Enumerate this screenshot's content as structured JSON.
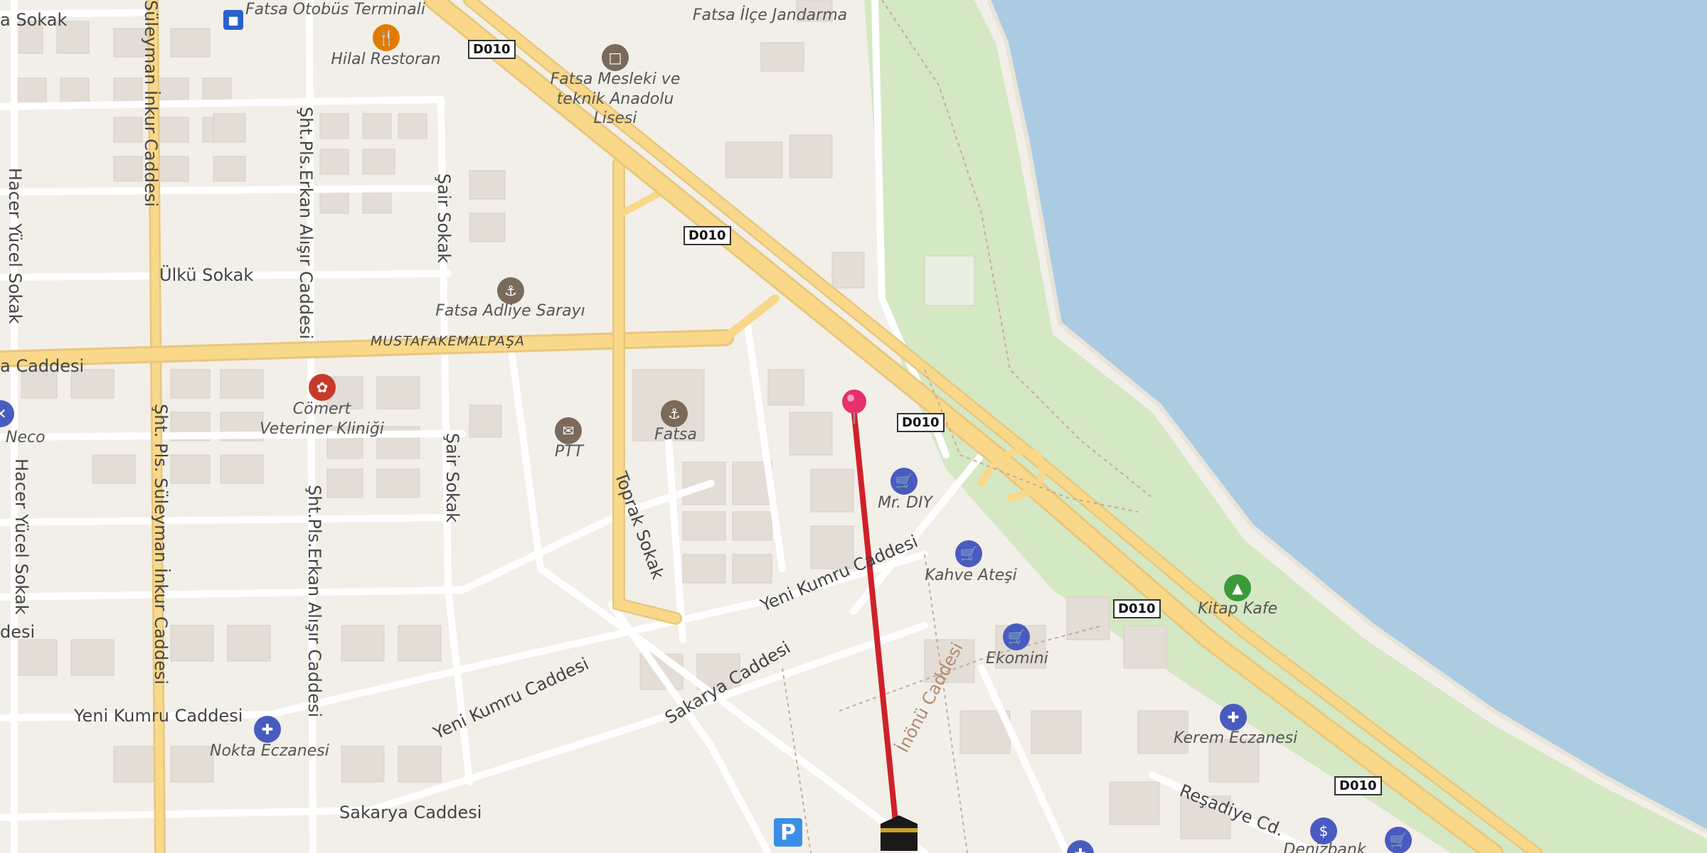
{
  "map": {
    "road_shields": [
      "D010",
      "D010",
      "D010",
      "D010",
      "D010"
    ],
    "streets": [
      "a Sokak",
      "Süleyman İnkur Caddesi",
      "Hacer Yücel Sokak",
      "Şht.Pls.Erkan Alışır Caddesi",
      "Şair Sokak",
      "Ülkü Sokak",
      "MUSTAFAKEMALPAŞA",
      "a Caddesi",
      "Şht. Pls. Süleyman İnkur Caddesi",
      "Şair Sokak",
      "Hacer Yücel Sokak",
      "Şht.Pls.Erkan Alışır Caddesi",
      "Toprak Sokak",
      "Yeni Kumru Caddesi",
      "Yeni Kumru Caddesi",
      "Yeni Kumru Caddesi",
      "Sakarya Caddesi",
      "Sakarya Caddesi",
      "İnönü Caddesi",
      "Reşadiye Cd.",
      "desi"
    ],
    "pois": [
      {
        "name": "Fatsa Otobüs Terminali",
        "icon": "bus-stop-icon"
      },
      {
        "name": "Hilal Restoran",
        "icon": "restaurant-icon"
      },
      {
        "name": "Fatsa İlçe Jandarma",
        "icon": "police-icon"
      },
      {
        "name": "Fatsa Mesleki ve teknik Anadolu Lisesi",
        "icon": "school-icon"
      },
      {
        "name": "Fatsa Adliye Sarayı",
        "icon": "courthouse-icon"
      },
      {
        "name": "Cömert Veteriner Kliniği",
        "icon": "veterinary-icon"
      },
      {
        "name": "PTT",
        "icon": "post-office-icon"
      },
      {
        "name": "Fatsa",
        "icon": "town-hall-icon"
      },
      {
        "name": "Neco",
        "icon": "shop-icon"
      },
      {
        "name": "Mr. DIY",
        "icon": "shopping-basket-icon"
      },
      {
        "name": "Kahve Ateşi",
        "icon": "shopping-basket-icon"
      },
      {
        "name": "Ekomini",
        "icon": "shopping-basket-icon"
      },
      {
        "name": "Kitap Kafe",
        "icon": "tree-icon"
      },
      {
        "name": "Kerem Eczanesi",
        "icon": "pharmacy-icon"
      },
      {
        "name": "Nokta Eczanesi",
        "icon": "pharmacy-icon"
      },
      {
        "name": "Denizbank",
        "icon": "bank-icon"
      }
    ],
    "parking_label": "P",
    "pin": {
      "icon": "location-pin-icon"
    },
    "destination": {
      "icon": "kaaba-icon"
    },
    "route_color": "#d0202a",
    "water_color": "#aacbe2",
    "park_color": "#d4e8c4"
  }
}
